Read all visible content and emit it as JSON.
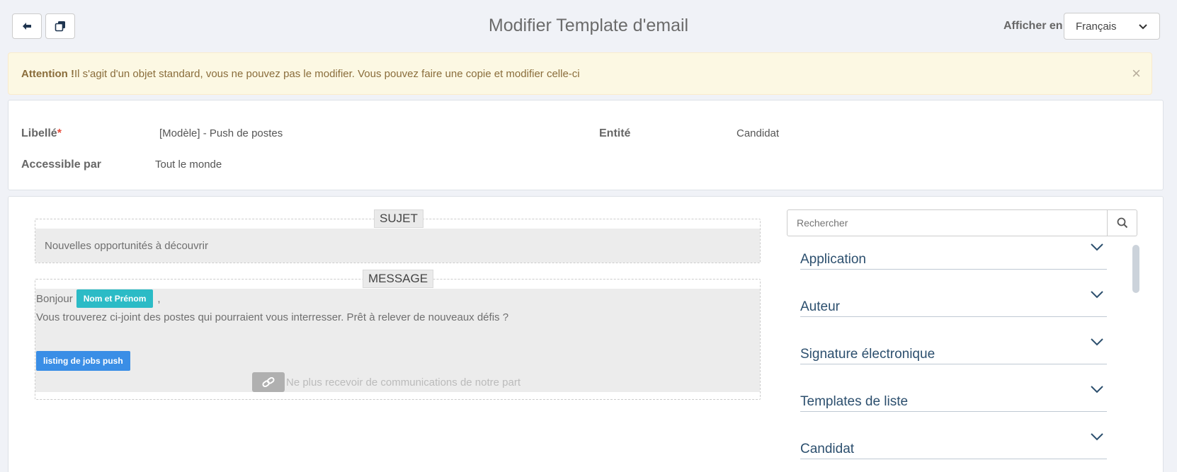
{
  "header": {
    "title": "Modifier Template d'email",
    "back_icon": "arrow-left-icon",
    "copy_icon": "copy-icon",
    "lang_label": "Afficher en",
    "lang_value": "Français"
  },
  "alert": {
    "strong": "Attention !",
    "text": "Il s'agit d'un objet standard, vous ne pouvez pas le modifier. Vous pouvez faire une copie et modifier celle-ci",
    "close": "×"
  },
  "info": {
    "libelle_label": "Libellé",
    "required_mark": "*",
    "libelle_value": "[Modèle] - Push de postes",
    "entite_label": "Entité",
    "entite_value": "Candidat",
    "accessible_label": "Accessible par",
    "accessible_value": "Tout le monde"
  },
  "editor": {
    "subject_title": "SUJET",
    "subject_value": "Nouvelles opportunités à découvrir",
    "message_title": "MESSAGE",
    "greeting": "Bonjour",
    "name_tag": "Nom et Prénom",
    "comma": ",",
    "body_line": "Vous trouverez ci-joint des postes qui pourraient vous interresser. Prêt à relever de nouveaux défis ?",
    "jobs_tag": "listing de jobs push",
    "unsubscribe": "Ne plus recevoir de communications de notre part"
  },
  "sidebar": {
    "search_placeholder": "Rechercher",
    "items": [
      {
        "label": "Application"
      },
      {
        "label": "Auteur"
      },
      {
        "label": "Signature électronique"
      },
      {
        "label": "Templates de liste"
      },
      {
        "label": "Candidat"
      }
    ]
  },
  "colors": {
    "alert_bg": "#fcf8e3",
    "alert_text": "#8a6d3b",
    "tag_teal": "#2bbbc6",
    "tag_blue": "#3a8ee6",
    "accordion_text": "#2c4f6e"
  }
}
